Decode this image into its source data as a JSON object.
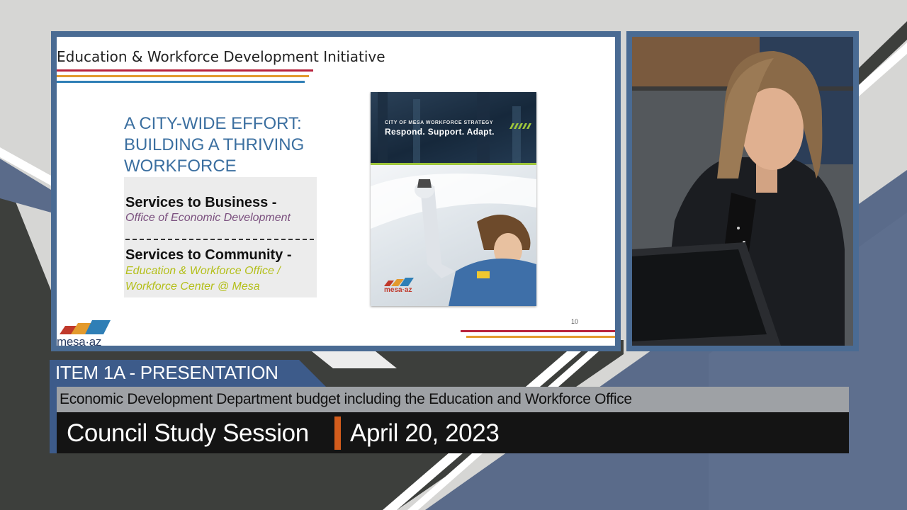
{
  "slide": {
    "title": "Education & Workforce Development Initiative",
    "heading_lines": [
      "A CITY-WIDE EFFORT:",
      "BUILDING A THRIVING",
      "WORKFORCE"
    ],
    "services": [
      {
        "title": "Services to Business -",
        "sub": [
          "Office of Economic Development"
        ]
      },
      {
        "title": "Services to Community -",
        "sub": [
          "Education & Workforce Office /",
          "Workforce Center @ Mesa"
        ]
      }
    ],
    "cover": {
      "small_text": "CITY OF MESA WORKFORCE STRATEGY",
      "big_text": "Respond. Support. Adapt.",
      "logo_text": "mesa·az"
    },
    "page_number": "10",
    "logo_text": "mesa·az"
  },
  "lower_third": {
    "item_label": "ITEM 1A - PRESENTATION",
    "description": "Economic Development Department budget including the Education and Workforce Office",
    "session": "Council Study Session",
    "date": "April 20, 2023"
  },
  "colors": {
    "frame_blue": "#4a6b93",
    "tab_blue": "#3d5b8a",
    "heading_blue": "#3b6fa0",
    "business_purple": "#7a4f7e",
    "community_green": "#b4bf1a",
    "divider_orange": "#d35c1c",
    "rule_red": "#b8233d",
    "rule_orange": "#e39a2d",
    "rule_blue": "#2f7fb6"
  }
}
